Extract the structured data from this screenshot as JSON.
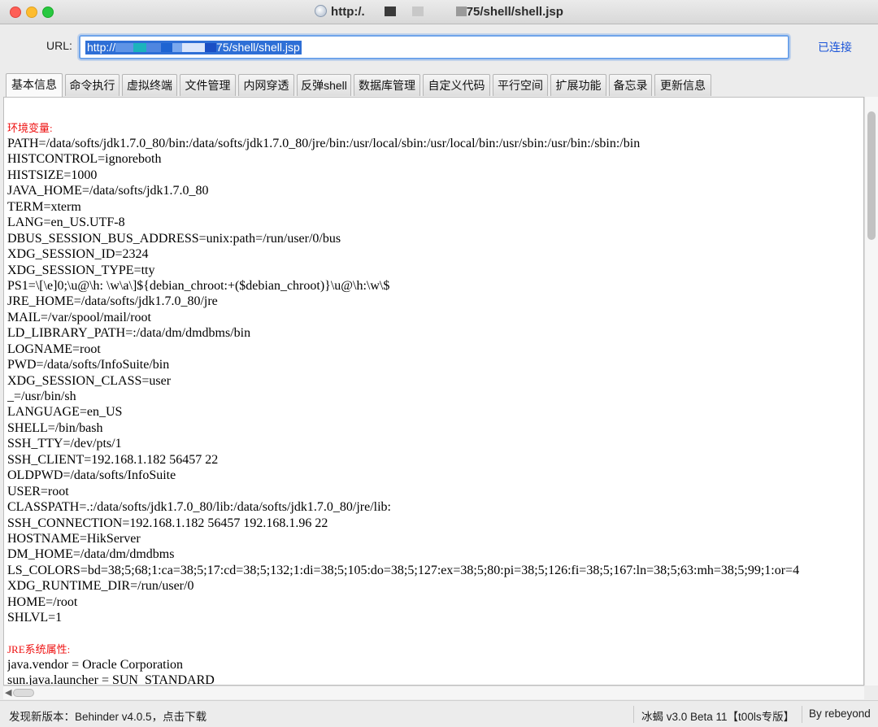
{
  "window": {
    "title_prefix": "http:/.",
    "title_suffix": "75/shell/shell.jsp"
  },
  "url_bar": {
    "label": "URL:",
    "value_prefix": "http://",
    "value_suffix": "75/shell/shell.jsp",
    "status": "已连接"
  },
  "tabs": [
    {
      "label": "基本信息",
      "active": true
    },
    {
      "label": "命令执行"
    },
    {
      "label": "虚拟终端"
    },
    {
      "label": "文件管理"
    },
    {
      "label": "内网穿透"
    },
    {
      "label": "反弹shell"
    },
    {
      "label": "数据库管理"
    },
    {
      "label": "自定义代码"
    },
    {
      "label": "平行空间"
    },
    {
      "label": "扩展功能"
    },
    {
      "label": "备忘录"
    },
    {
      "label": "更新信息"
    }
  ],
  "content": {
    "env_title": "环境变量:",
    "env_vars": [
      "PATH=/data/softs/jdk1.7.0_80/bin:/data/softs/jdk1.7.0_80/jre/bin:/usr/local/sbin:/usr/local/bin:/usr/sbin:/usr/bin:/sbin:/bin",
      "HISTCONTROL=ignoreboth",
      "HISTSIZE=1000",
      "JAVA_HOME=/data/softs/jdk1.7.0_80",
      "TERM=xterm",
      "LANG=en_US.UTF-8",
      "DBUS_SESSION_BUS_ADDRESS=unix:path=/run/user/0/bus",
      "XDG_SESSION_ID=2324",
      "XDG_SESSION_TYPE=tty",
      "PS1=\\[\\e]0;\\u@\\h: \\w\\a\\]${debian_chroot:+($debian_chroot)}\\u@\\h:\\w\\$",
      "JRE_HOME=/data/softs/jdk1.7.0_80/jre",
      "MAIL=/var/spool/mail/root",
      "LD_LIBRARY_PATH=:/data/dm/dmdbms/bin",
      "LOGNAME=root",
      "PWD=/data/softs/InfoSuite/bin",
      "XDG_SESSION_CLASS=user",
      "_=/usr/bin/sh",
      "LANGUAGE=en_US",
      "SHELL=/bin/bash",
      "SSH_TTY=/dev/pts/1",
      "SSH_CLIENT=192.168.1.182 56457 22",
      "OLDPWD=/data/softs/InfoSuite",
      "USER=root",
      "CLASSPATH=.:/data/softs/jdk1.7.0_80/lib:/data/softs/jdk1.7.0_80/jre/lib:",
      "SSH_CONNECTION=192.168.1.182 56457 192.168.1.96 22",
      "HOSTNAME=HikServer",
      "DM_HOME=/data/dm/dmdbms",
      "LS_COLORS=bd=38;5;68;1:ca=38;5;17:cd=38;5;132;1:di=38;5;105:do=38;5;127:ex=38;5;80:pi=38;5;126:fi=38;5;167:ln=38;5;63:mh=38;5;99;1:or=4",
      "XDG_RUNTIME_DIR=/run/user/0",
      "HOME=/root",
      "SHLVL=1"
    ],
    "jre_title": "JRE系统属性:",
    "jre_props": [
      "java.vendor = Oracle Corporation",
      "sun.java.launcher = SUN_STANDARD"
    ]
  },
  "status_bar": {
    "left": "发现新版本：Behinder v4.0.5，点击下载",
    "middle": "冰蝎 v3.0 Beta 11【t00ls专版】",
    "right": "By rebeyond"
  },
  "colors": {
    "section_title": "#ee1111",
    "link": "#1a54d8",
    "selection": "#2e6fd6"
  }
}
